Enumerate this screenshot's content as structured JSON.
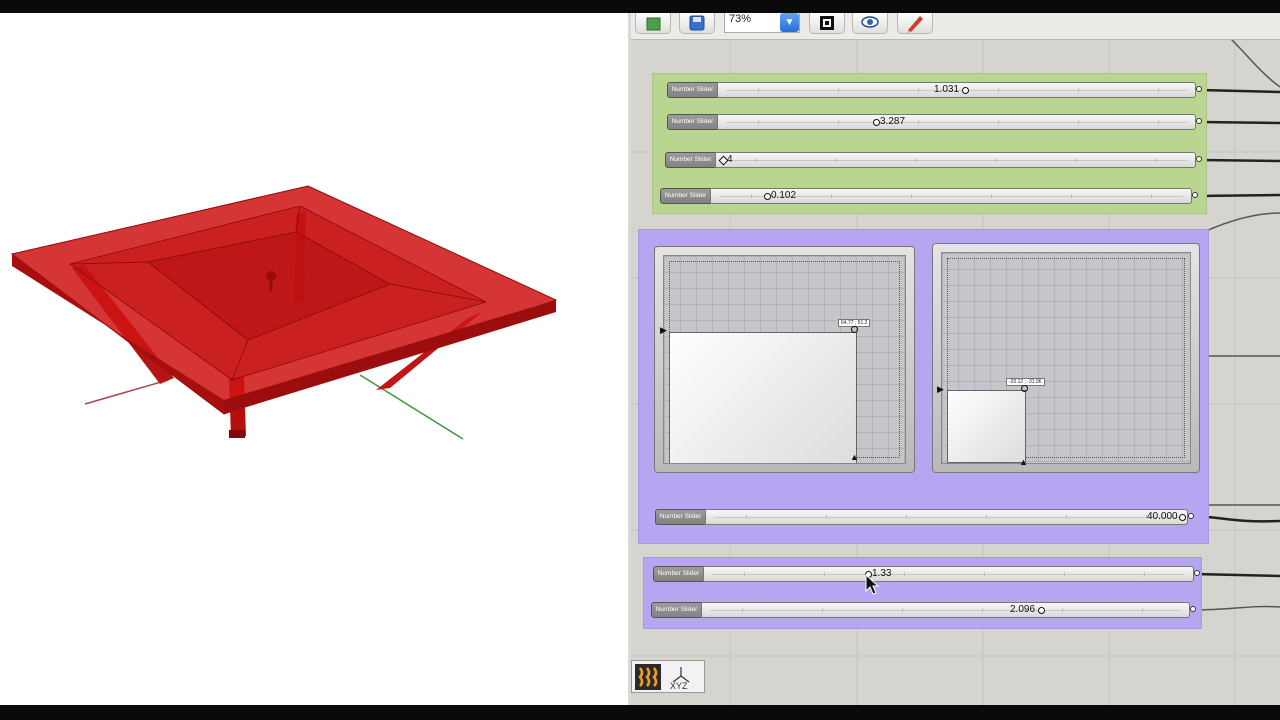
{
  "toolbar": {
    "zoom_value": "73%",
    "icons": [
      "open-file-icon",
      "save-icon",
      "zoom-extents-icon",
      "preview-eye-icon",
      "sketch-pen-icon"
    ]
  },
  "sliders": {
    "s1": {
      "label": "Number Slider",
      "value": "1.031"
    },
    "s2": {
      "label": "Number Slider",
      "value": "3.287"
    },
    "s3": {
      "label": "Number Slider",
      "value": "4"
    },
    "s4": {
      "label": "Number Slider",
      "value": "0.102"
    },
    "s5": {
      "label": "Number Slider",
      "value": "40.000"
    },
    "s6": {
      "label": "Number Slider",
      "value": "1.33"
    },
    "s7": {
      "label": "Number Slider",
      "value": "2.096"
    }
  },
  "graphs": {
    "g1": {
      "tag": "64.77 ; 51.2"
    },
    "g2": {
      "tag": "-20.12 ; -31.96"
    }
  },
  "colors": {
    "model_red": "#c41010",
    "green_group": "#b9d58f",
    "purple_group": "#b6a6f2",
    "canvas": "#d5d4cf"
  },
  "bottom_icons": [
    "bake-icon",
    "xyz-axis-icon"
  ]
}
